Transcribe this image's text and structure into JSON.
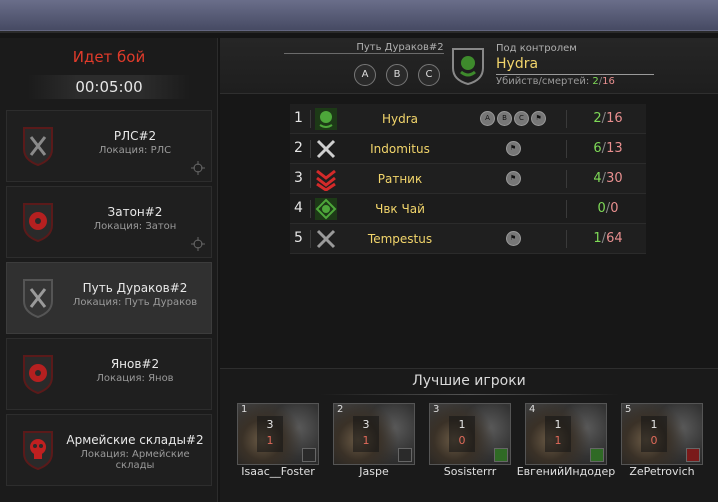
{
  "battle": {
    "status": "Идет бой",
    "timer": "00:05:00"
  },
  "locations": [
    {
      "title": "РЛС#2",
      "subtitle": "Локация: РЛС",
      "emblem": "crossed-swords-icon"
    },
    {
      "title": "Затон#2",
      "subtitle": "Локация: Затон",
      "emblem": "radiation-icon"
    },
    {
      "title": "Путь Дураков#2",
      "subtitle": "Локация: Путь Дураков",
      "emblem": "crossed-swords-icon"
    },
    {
      "title": "Янов#2",
      "subtitle": "Локация: Янов",
      "emblem": "radiation-icon"
    },
    {
      "title": "Армейские склады#2",
      "subtitle": "Локация: Армейские склады",
      "emblem": "skull-icon"
    }
  ],
  "header": {
    "location": "Путь Дураков#2",
    "points": [
      "A",
      "B",
      "C"
    ],
    "control_label": "Под контролем",
    "faction": "Hydra",
    "kd_label": "Убийств/смертей:",
    "kills": "2",
    "deaths": "16"
  },
  "factions": [
    {
      "rank": "1",
      "name": "Hydra",
      "points": [
        "A",
        "B",
        "C"
      ],
      "flag": true,
      "kills": "2",
      "deaths": "16"
    },
    {
      "rank": "2",
      "name": "Indomitus",
      "points": [],
      "flag": true,
      "kills": "6",
      "deaths": "13"
    },
    {
      "rank": "3",
      "name": "Ратник",
      "points": [],
      "flag": true,
      "kills": "4",
      "deaths": "30"
    },
    {
      "rank": "4",
      "name": "Чвк Чай",
      "points": [],
      "flag": false,
      "kills": "0",
      "deaths": "0"
    },
    {
      "rank": "5",
      "name": "Tempestus",
      "points": [],
      "flag": true,
      "kills": "1",
      "deaths": "64"
    }
  ],
  "best_players": {
    "title": "Лучшие игроки",
    "players": [
      {
        "num": "1",
        "name": "Isaac__Foster",
        "stat_top": "3",
        "stat_bottom": "1"
      },
      {
        "num": "2",
        "name": "Jaspe",
        "stat_top": "3",
        "stat_bottom": "1"
      },
      {
        "num": "3",
        "name": "Sosisterrr",
        "stat_top": "1",
        "stat_bottom": "0"
      },
      {
        "num": "4",
        "name": "ЕвгенийИндодер",
        "stat_top": "1",
        "stat_bottom": "1"
      },
      {
        "num": "5",
        "name": "ZePetrovich",
        "stat_top": "1",
        "stat_bottom": "0"
      }
    ]
  },
  "colors": {
    "accent_red": "#e03b2b",
    "faction_yellow": "#f2d56b",
    "kill_green": "#7ed957",
    "death_red": "#e88f8f"
  }
}
